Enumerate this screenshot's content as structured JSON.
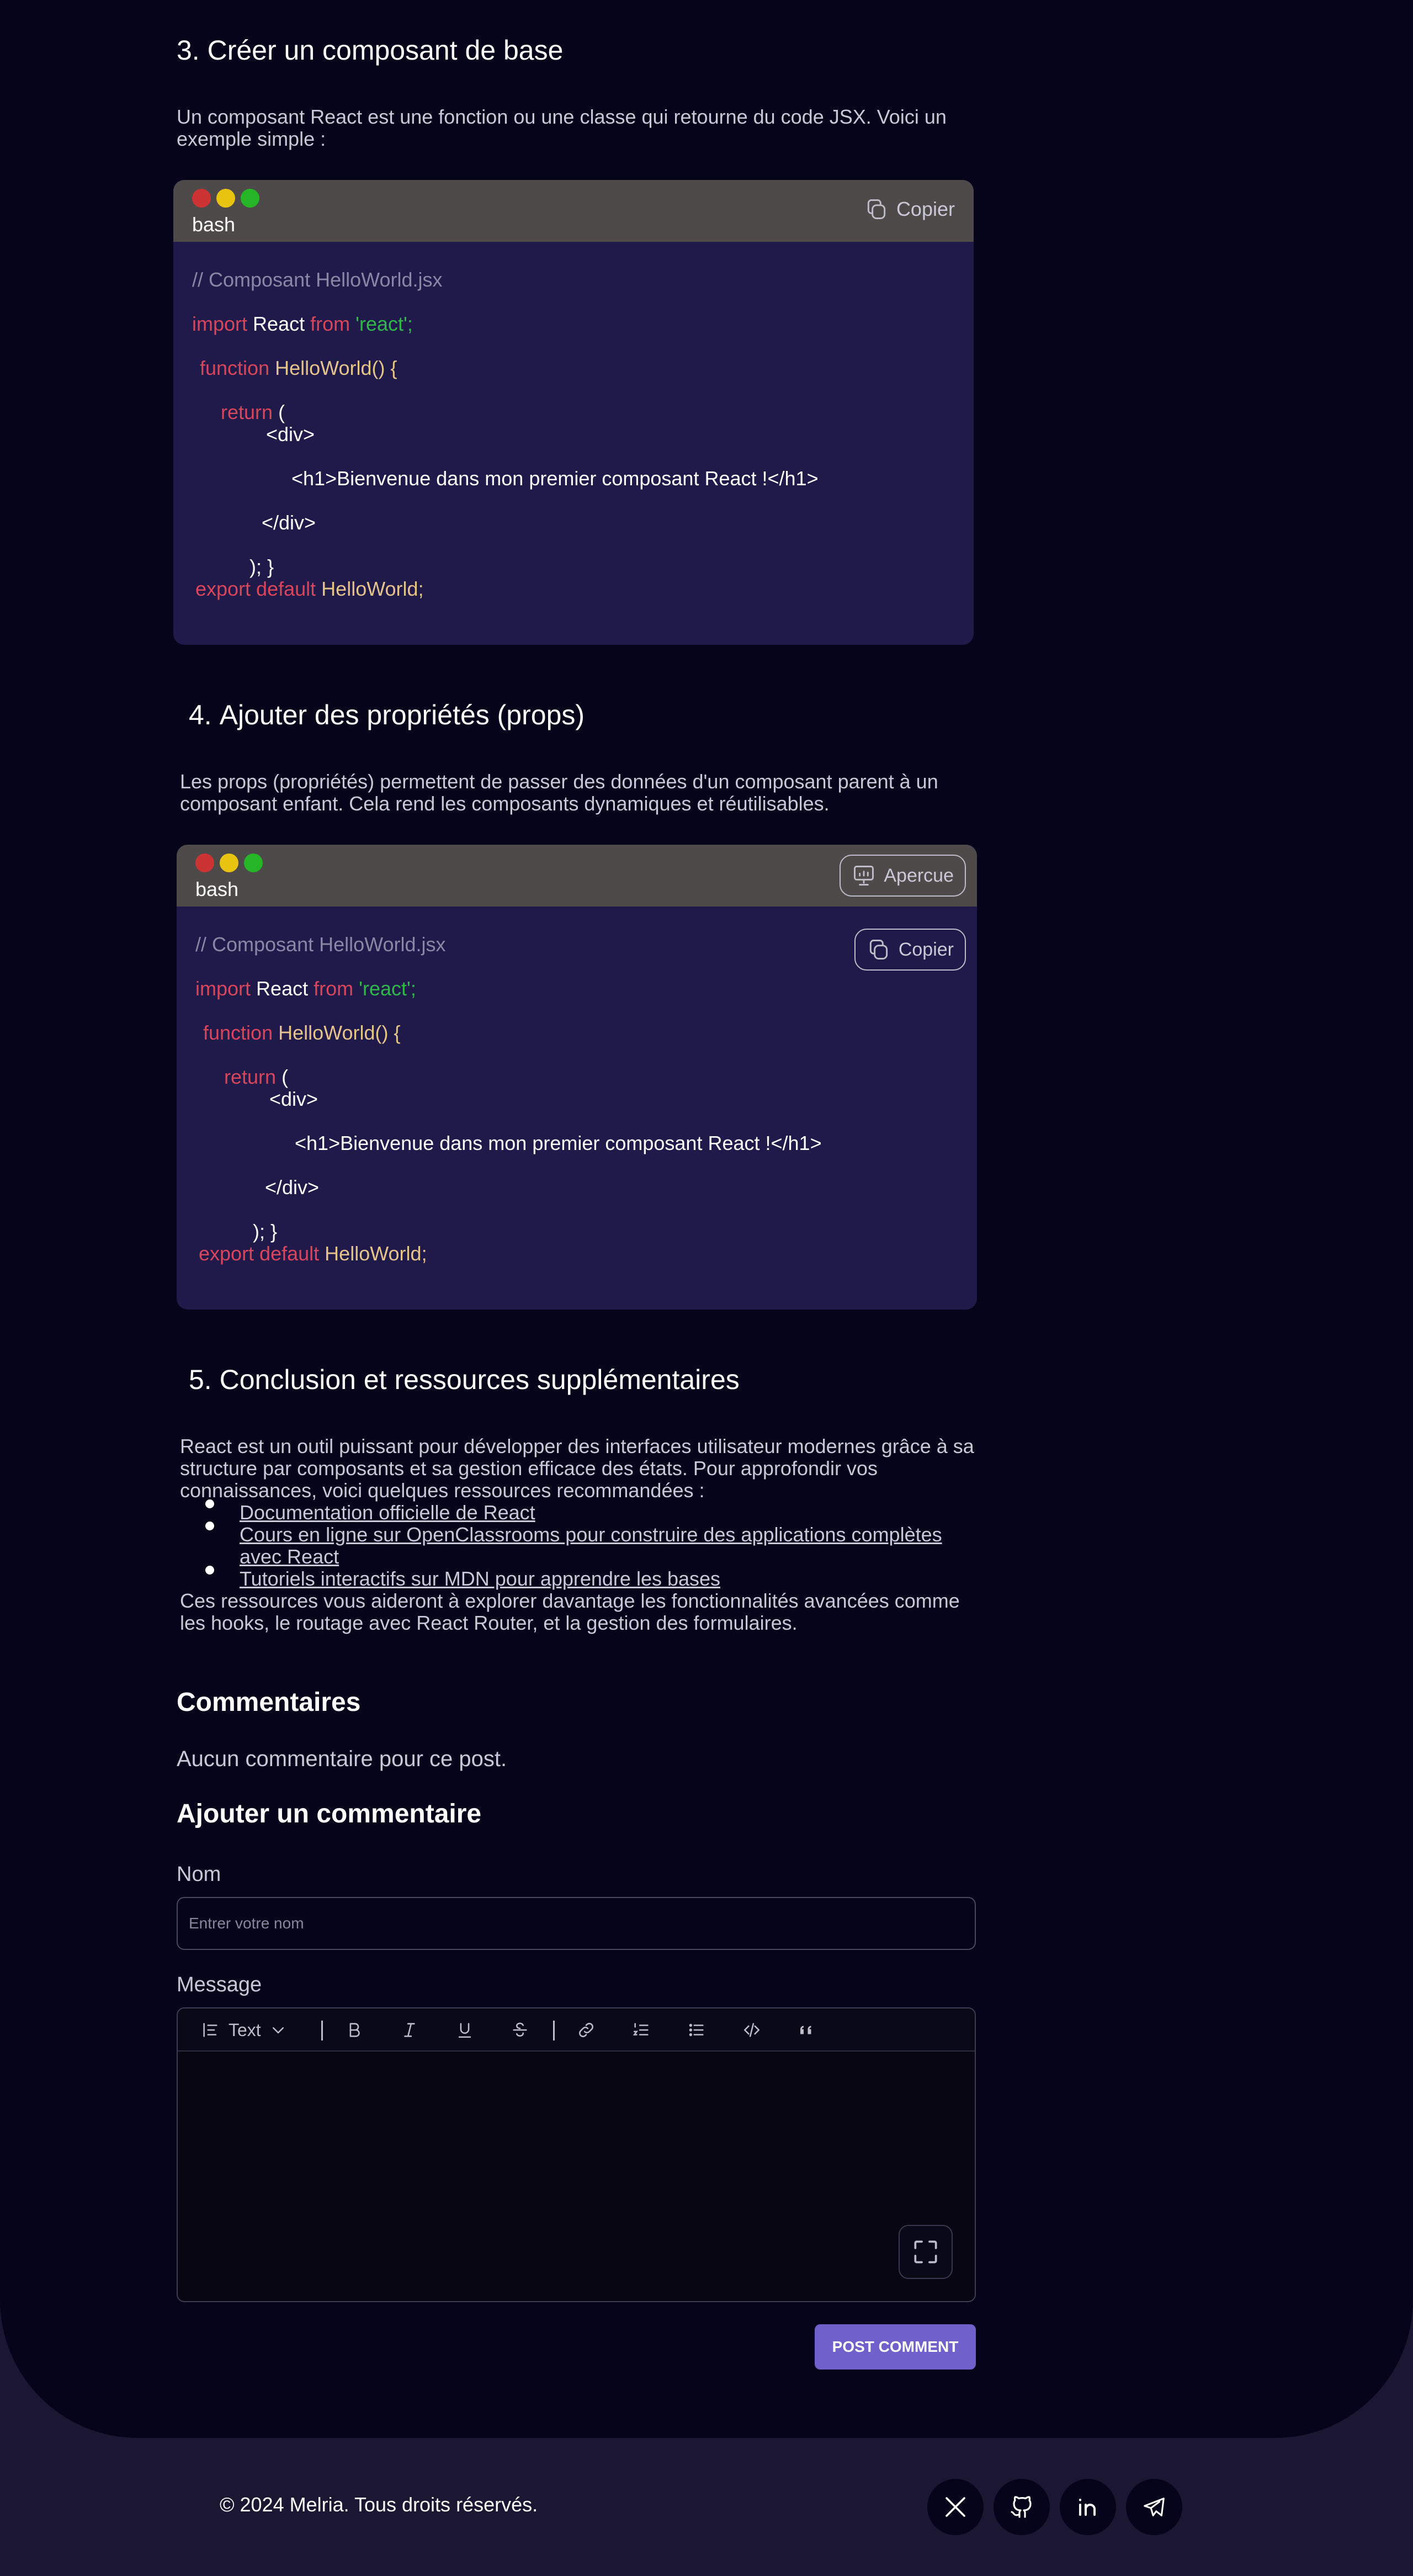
{
  "section3": {
    "heading": "3. Créer un composant de base",
    "description_line1": "Un composant React est une fonction ou une classe qui retourne du code JSX. Voici un",
    "description_line2": "exemple simple :",
    "code": {
      "language": "bash",
      "copy_label": "Copier",
      "comment": "// Composant HelloWorld.jsx",
      "import_kw": "import",
      "import_name": "React",
      "from_kw": "from",
      "import_str": "'react';",
      "function_kw": "function",
      "function_name": "HelloWorld() {",
      "return_kw": "return",
      "return_paren": "(",
      "div_open": "<div>",
      "h1_line": "<h1>Bienvenue dans mon premier composant React !</h1>",
      "div_close": "</div>",
      "closing": "); }",
      "export_kw": "export default",
      "export_name": "HelloWorld;"
    }
  },
  "section4": {
    "heading_num": "4.",
    "heading_text": "Ajouter des propriétés (props)",
    "description_line1": "Les props (propriétés) permettent de passer des données d'un composant parent à un",
    "description_line2": "composant enfant. Cela rend les composants dynamiques et réutilisables.",
    "code": {
      "language": "bash",
      "preview_label": "Apercue",
      "copy_label": "Copier",
      "comment": "// Composant HelloWorld.jsx",
      "import_kw": "import",
      "import_name": "React",
      "from_kw": "from",
      "import_str": "'react';",
      "function_kw": "function",
      "function_name": "HelloWorld() {",
      "return_kw": "return",
      "return_paren": "(",
      "div_open": "<div>",
      "h1_line": "<h1>Bienvenue dans mon premier composant React !</h1>",
      "div_close": "</div>",
      "closing": "); }",
      "export_kw": "export default",
      "export_name": "HelloWorld;"
    }
  },
  "section5": {
    "heading_num": "5.",
    "heading_text": "Conclusion et ressources supplémentaires",
    "intro_line1": "React est un outil puissant pour développer des interfaces utilisateur modernes grâce à sa",
    "intro_line2": "structure par composants et sa gestion efficace des états. Pour approfondir vos",
    "intro_line3": "connaissances, voici quelques ressources recommandées :",
    "links": [
      {
        "line1": "Documentation officielle de React",
        "line2": ""
      },
      {
        "line1": "Cours en ligne sur OpenClassrooms pour construire des applications complètes",
        "line2": "avec React"
      },
      {
        "line1": "Tutoriels interactifs sur MDN pour apprendre les bases",
        "line2": ""
      }
    ],
    "outro_line1": "Ces ressources vous aideront à explorer davantage les fonctionnalités avancées comme",
    "outro_line2": "les hooks, le routage avec React Router, et la gestion des formulaires."
  },
  "comments": {
    "heading": "Commentaires",
    "empty_text": "Aucun commentaire pour ce post.",
    "add_heading": "Ajouter un commentaire",
    "name_label": "Nom",
    "name_placeholder": "Entrer votre nom",
    "message_label": "Message",
    "toolbar": {
      "text_style_label": "Text",
      "icons": [
        "text-align-icon",
        "chevron-down-icon",
        "bold-icon",
        "italic-icon",
        "underline-icon",
        "strikethrough-icon",
        "link-icon",
        "ordered-list-icon",
        "bullet-list-icon",
        "code-icon",
        "quote-icon",
        "fullscreen-icon"
      ]
    },
    "post_button": "POST COMMENT"
  },
  "footer": {
    "copyright": "© 2024 Melria. Tous droits réservés.",
    "socials": [
      "x-icon",
      "github-icon",
      "linkedin-icon",
      "telegram-icon"
    ]
  },
  "colors": {
    "page_bg": "#05041a",
    "footer_bg": "#1b1733",
    "code_bg": "#201a4b",
    "code_header": "#4f4a4a",
    "keyword": "#d9455a",
    "string": "#2fb84a",
    "function": "#e5c38a",
    "accent": "#7060cc"
  }
}
